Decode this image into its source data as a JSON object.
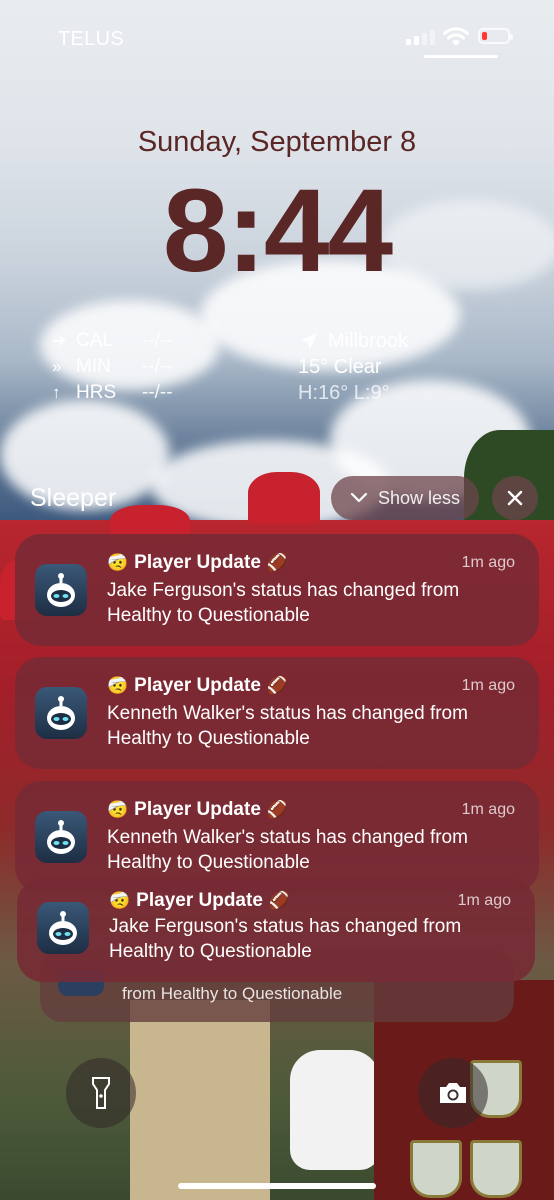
{
  "status_bar": {
    "carrier": "TELUS",
    "battery_color": "#ff3b30"
  },
  "lock_screen": {
    "date": "Sunday, September 8",
    "time": "8:44"
  },
  "fitness_widget": {
    "rows": [
      {
        "icon": "arrow-right-icon",
        "label": "CAL",
        "value": "--/--"
      },
      {
        "icon": "double-arrow-right-icon",
        "label": "MIN",
        "value": "--/--"
      },
      {
        "icon": "arrow-up-icon",
        "label": "HRS",
        "value": "--/--"
      }
    ]
  },
  "weather_widget": {
    "location": "Millbrook",
    "condition": "15° Clear",
    "high_low": "H:16° L:9°"
  },
  "notification_group": {
    "app_name": "Sleeper",
    "show_less_label": "Show less",
    "notifications": [
      {
        "title": "Player Update",
        "time": "1m ago",
        "body": "Jake Ferguson's status has changed from Healthy to Questionable"
      },
      {
        "title": "Player Update",
        "time": "1m ago",
        "body": "Kenneth Walker's status has changed from Healthy to Questionable"
      },
      {
        "title": "Player Update",
        "time": "1m ago",
        "body": "Kenneth Walker's status has changed from Healthy to Questionable"
      },
      {
        "title": "Player Update",
        "time": "1m ago",
        "body": "Jake Ferguson's status has changed from Healthy to Questionable"
      }
    ],
    "stacked_behind_body": "from Healthy to Questionable"
  },
  "colors": {
    "clock_color": "#5a2626",
    "notification_bg": "#762a34"
  }
}
